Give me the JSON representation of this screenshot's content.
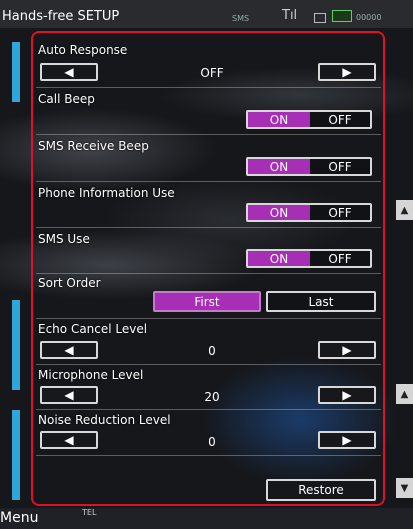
{
  "header": {
    "title": "Hands-free SETUP",
    "status_sms": "SMS",
    "status_signal": "Tıl",
    "status_tail": "00000"
  },
  "settings": {
    "auto_response": {
      "label": "Auto Response",
      "value": "OFF",
      "left_arrow": "◀",
      "right_arrow": "▶"
    },
    "call_beep": {
      "label": "Call Beep",
      "on_label": "ON",
      "off_label": "OFF"
    },
    "sms_receive_beep": {
      "label": "SMS Receive Beep",
      "on_label": "ON",
      "off_label": "OFF"
    },
    "phone_information_use": {
      "label": "Phone Information Use",
      "on_label": "ON",
      "off_label": "OFF"
    },
    "sms_use": {
      "label": "SMS Use",
      "on_label": "ON",
      "off_label": "OFF"
    },
    "sort_order": {
      "label": "Sort Order",
      "first_label": "First",
      "last_label": "Last",
      "selected": "First"
    },
    "echo_cancel_level": {
      "label": "Echo Cancel Level",
      "value": "0",
      "left_arrow": "◀",
      "right_arrow": "▶"
    },
    "microphone_level": {
      "label": "Microphone Level",
      "value": "20",
      "left_arrow": "◀",
      "right_arrow": "▶"
    },
    "noise_reduction_level": {
      "label": "Noise Reduction Level",
      "value": "0",
      "left_arrow": "◀",
      "right_arrow": "▶"
    }
  },
  "footer": {
    "restore_label": "Restore",
    "menu_label": "Menu",
    "tel_label": "TEL"
  },
  "scroll": {
    "up_glyph": "▲",
    "down_glyph": "▼"
  },
  "colors": {
    "selected_purple": "#a62fb5",
    "highlight_border": "#e0102a",
    "side_accent": "#2fa6d8"
  }
}
